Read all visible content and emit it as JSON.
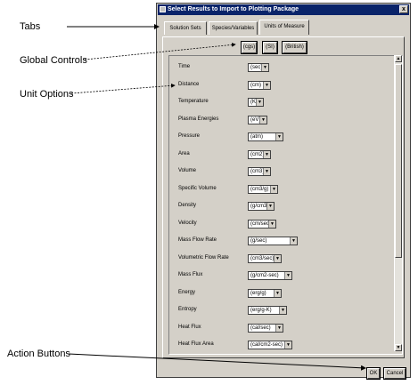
{
  "annotations": {
    "tabs": "Tabs",
    "global_controls": "Global Controls",
    "unit_options": "Unit Options",
    "action_buttons": "Action Buttons"
  },
  "window": {
    "title": "Select  Results to Import to Plotting Package",
    "close_label": "x"
  },
  "tabs": [
    "Solution Sets",
    "Species/Variables",
    "Units of Measure"
  ],
  "active_tab": "Units of Measure",
  "unit_systems": [
    "(cgs)",
    "(SI)",
    "(British)"
  ],
  "units": [
    {
      "label": "Time",
      "value": "(sec)"
    },
    {
      "label": "Distance",
      "value": "(cm)"
    },
    {
      "label": "Temperature",
      "value": "(K)"
    },
    {
      "label": "Plasma Energies",
      "value": "(eV)"
    },
    {
      "label": "Pressure",
      "value": "(atm)"
    },
    {
      "label": "Area",
      "value": "(cm2)"
    },
    {
      "label": "Volume",
      "value": "(cm3)"
    },
    {
      "label": "Specific Volume",
      "value": "(cm3/g)"
    },
    {
      "label": "Density",
      "value": "(g/cm3)"
    },
    {
      "label": "Velocity",
      "value": "(cm/sec)"
    },
    {
      "label": "Mass Flow Rate",
      "value": "(g/sec)"
    },
    {
      "label": "Volumetric Flow Rate",
      "value": "(cm3/sec)"
    },
    {
      "label": "Mass Flux",
      "value": "(g/cm2-sec)"
    },
    {
      "label": "Energy",
      "value": "(erg/g)"
    },
    {
      "label": "Entropy",
      "value": "(erg/g-K)"
    },
    {
      "label": "Heat Flux",
      "value": "(cal/sec)"
    },
    {
      "label": "Heat Flux Area",
      "value": "(cal/cm2-sec)"
    }
  ],
  "buttons": {
    "ok": "OK",
    "cancel": "Cancel"
  },
  "icons": {
    "dropdown": "chevron-down-icon",
    "scroll_up": "arrow-up-icon",
    "scroll_down": "arrow-down-icon"
  }
}
